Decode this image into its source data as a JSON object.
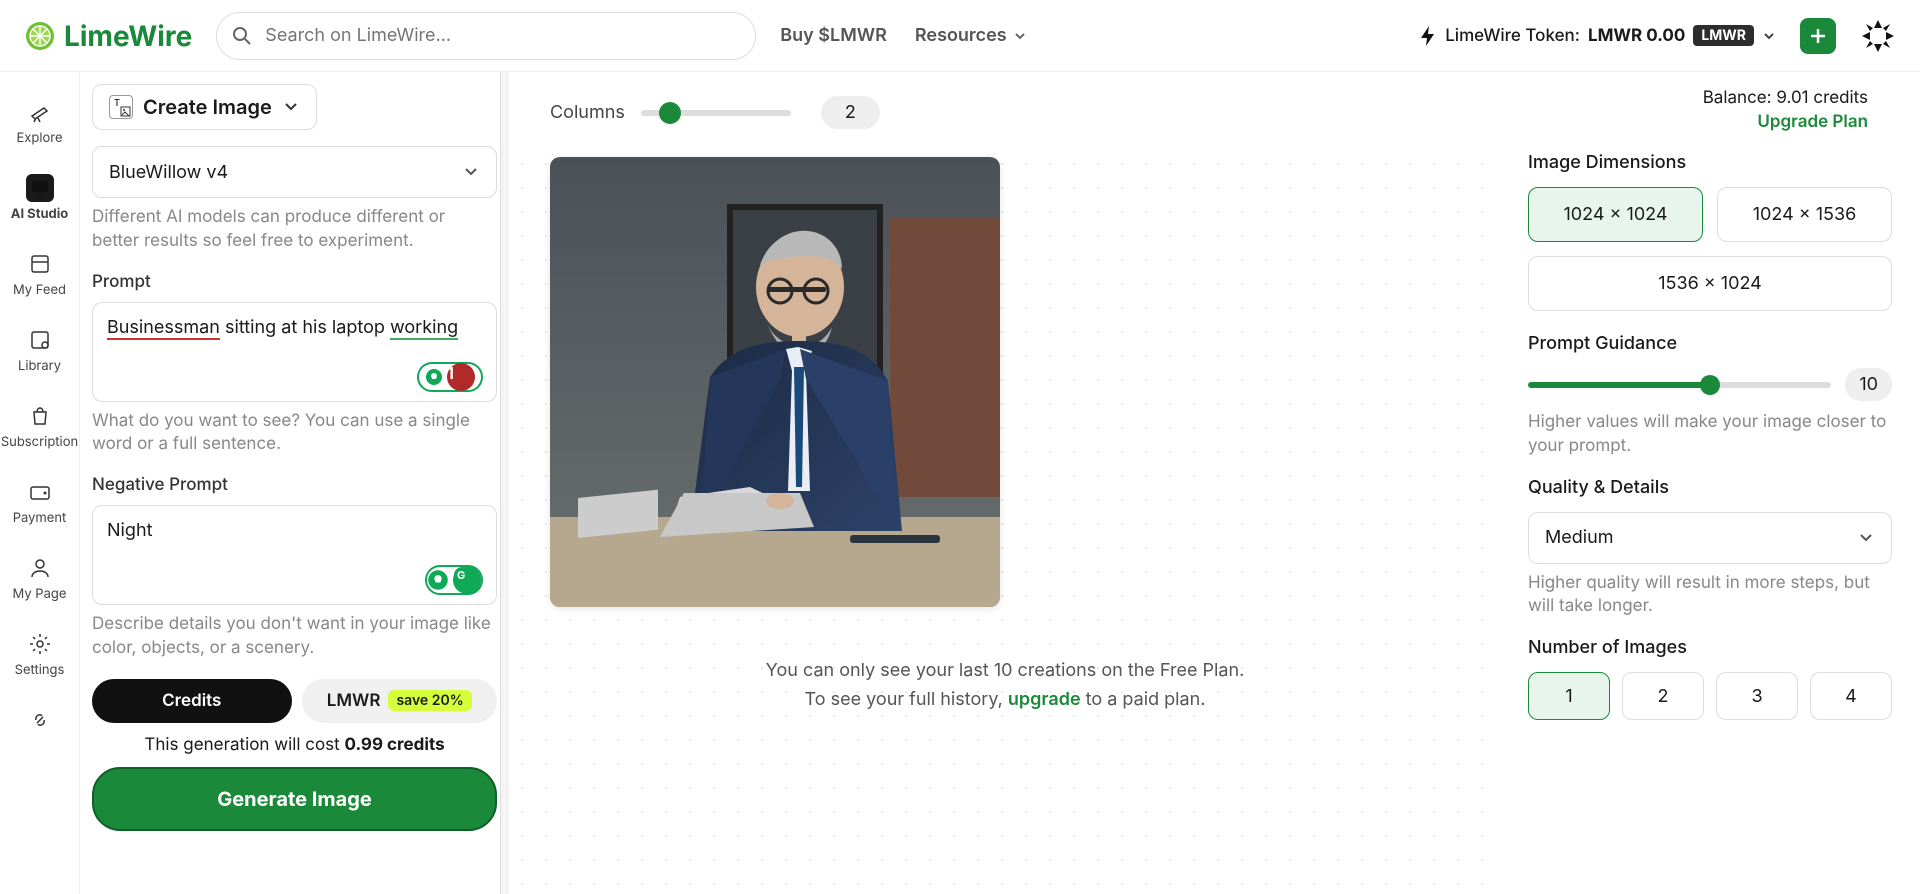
{
  "brand": "LimeWire",
  "search_placeholder": "Search on LimeWire...",
  "nav": {
    "buy": "Buy $LMWR",
    "resources": "Resources"
  },
  "token": {
    "label": "LimeWire Token:",
    "value": "LMWR 0.00",
    "badge": "LMWR"
  },
  "balance": {
    "text": "Balance: 9.01 credits",
    "upgrade": "Upgrade Plan"
  },
  "sidebar": {
    "items": [
      {
        "label": "Explore"
      },
      {
        "label": "AI Studio"
      },
      {
        "label": "My Feed"
      },
      {
        "label": "Library"
      },
      {
        "label": "Subscription"
      },
      {
        "label": "Payment"
      },
      {
        "label": "My Page"
      },
      {
        "label": "Settings"
      }
    ]
  },
  "left": {
    "create_image": "Create Image",
    "model": "BlueWillow v4",
    "model_help": "Different AI models can produce different or better results so feel free to experiment.",
    "prompt_label": "Prompt",
    "prompt_value_1": "Businessman",
    "prompt_value_2": " sitting at his laptop ",
    "prompt_value_3": "working",
    "prompt_help": "What do you want to see? You can use a single word or a full sentence.",
    "neg_label": "Negative Prompt",
    "neg_value": "Night",
    "neg_help": "Describe details you don't want in your image like color, objects, or a scenery.",
    "credits_btn": "Credits",
    "lmwr_btn": "LMWR",
    "save_pill": "save 20%",
    "cost_prefix": "This generation will cost ",
    "cost_val": "0.99 credits",
    "generate": "Generate Image",
    "g_count": "1"
  },
  "center": {
    "columns_label": "Columns",
    "columns_value": "2",
    "history_line1": "You can only see your last 10 creations on the Free Plan.",
    "history_line2a": "To see your full history, ",
    "history_upgrade": "upgrade",
    "history_line2b": " to a paid plan."
  },
  "right": {
    "dim_label": "Image Dimensions",
    "dims": [
      "1024 x 1024",
      "1024 x 1536",
      "1536 x 1024"
    ],
    "pg_label": "Prompt Guidance",
    "pg_value": "10",
    "pg_help": "Higher values will make your image closer to your prompt.",
    "qd_label": "Quality & Details",
    "qd_value": "Medium",
    "qd_help": "Higher quality will result in more steps, but will take longer.",
    "num_label": "Number of Images",
    "nums": [
      "1",
      "2",
      "3",
      "4"
    ]
  }
}
